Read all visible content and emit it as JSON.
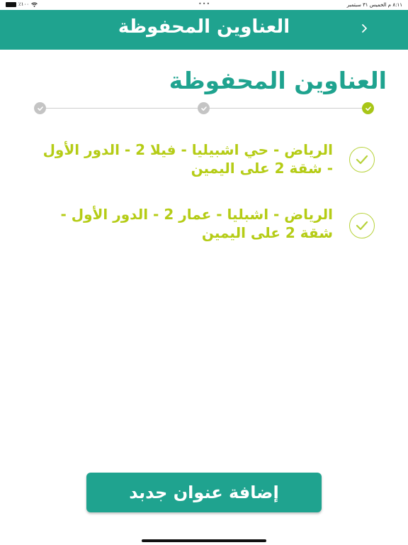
{
  "status_bar": {
    "time_date": "٨:١١ م  الخميس ٣١ سبتمبر",
    "dots": "•••",
    "battery": "٪١٠٠"
  },
  "header": {
    "title": "العناوين المحفوظة",
    "back_icon": "chevron-left-icon"
  },
  "page_title": "العناوين المحفوظة",
  "stepper": {
    "steps": [
      {
        "state": "active"
      },
      {
        "state": "inactive"
      },
      {
        "state": "inactive"
      }
    ]
  },
  "addresses": [
    {
      "text": "الرياض - حي اشبيليا - فيلا 2 - الدور الأول - شقة 2 على اليمين",
      "selected": true
    },
    {
      "text": "الرياض - اشبليا - عمار 2 - الدور الأول - شقة 2 على اليمين",
      "selected": true
    }
  ],
  "add_button_label": "إضافة عنوان جدبد",
  "colors": {
    "primary": "#1fa38f",
    "accent": "#b5cc16",
    "step_active": "#a8c617",
    "step_inactive": "#c4c4c4"
  }
}
